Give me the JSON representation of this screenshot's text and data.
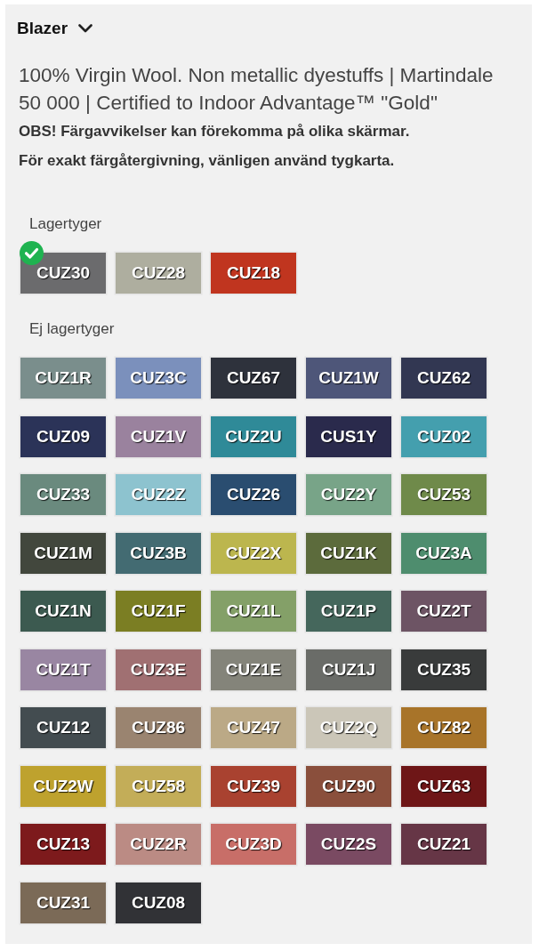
{
  "header": {
    "title": "Blazer",
    "expanded": true
  },
  "description": "100% Virgin Wool. Non metallic dyestuffs | Martindale 50 000 | Certified to Indoor Advantage™ \"Gold\"",
  "notes": [
    "OBS! Färgavvikelser kan förekomma på olika skärmar.",
    "För exakt färgåtergivning, vänligen använd tygkarta."
  ],
  "groups": [
    {
      "label": "Lagertyger",
      "swatches": [
        {
          "code": "CUZ30",
          "color": "#6b6b6d",
          "selected": true
        },
        {
          "code": "CUZ28",
          "color": "#aeae9f",
          "selected": false
        },
        {
          "code": "CUZ18",
          "color": "#c0351f",
          "selected": false
        }
      ]
    },
    {
      "label": "Ej lagertyger",
      "swatches": [
        {
          "code": "CUZ1R",
          "color": "#7a8e8c",
          "selected": false
        },
        {
          "code": "CUZ3C",
          "color": "#7b90bc",
          "selected": false
        },
        {
          "code": "CUZ67",
          "color": "#2e323c",
          "selected": false
        },
        {
          "code": "CUZ1W",
          "color": "#4e5679",
          "selected": false
        },
        {
          "code": "CUZ62",
          "color": "#323752",
          "selected": false
        },
        {
          "code": "CUZ09",
          "color": "#2b3358",
          "selected": false
        },
        {
          "code": "CUZ1V",
          "color": "#9a829e",
          "selected": false
        },
        {
          "code": "CUZ2U",
          "color": "#2f8a98",
          "selected": false
        },
        {
          "code": "CUS1Y",
          "color": "#2a2a4c",
          "selected": false
        },
        {
          "code": "CUZ02",
          "color": "#449fae",
          "selected": false
        },
        {
          "code": "CUZ33",
          "color": "#6a8a7e",
          "selected": false
        },
        {
          "code": "CUZ2Z",
          "color": "#8dc3cf",
          "selected": false
        },
        {
          "code": "CUZ26",
          "color": "#2a4d70",
          "selected": false
        },
        {
          "code": "CUZ2Y",
          "color": "#78a488",
          "selected": false
        },
        {
          "code": "CUZ53",
          "color": "#6f8a4a",
          "selected": false
        },
        {
          "code": "CUZ1M",
          "color": "#42473d",
          "selected": false
        },
        {
          "code": "CUZ3B",
          "color": "#436b72",
          "selected": false
        },
        {
          "code": "CUZ2X",
          "color": "#bcb64e",
          "selected": false
        },
        {
          "code": "CUZ1K",
          "color": "#5c6b3c",
          "selected": false
        },
        {
          "code": "CUZ3A",
          "color": "#4e8d6e",
          "selected": false
        },
        {
          "code": "CUZ1N",
          "color": "#3c5a50",
          "selected": false
        },
        {
          "code": "CUZ1F",
          "color": "#7b7e23",
          "selected": false
        },
        {
          "code": "CUZ1L",
          "color": "#84a068",
          "selected": false
        },
        {
          "code": "CUZ1P",
          "color": "#45675c",
          "selected": false
        },
        {
          "code": "CUZ2T",
          "color": "#6d5464",
          "selected": false
        },
        {
          "code": "CUZ1T",
          "color": "#9986a2",
          "selected": false
        },
        {
          "code": "CUZ3E",
          "color": "#a07072",
          "selected": false
        },
        {
          "code": "CUZ1E",
          "color": "#84847a",
          "selected": false
        },
        {
          "code": "CUZ1J",
          "color": "#6a6c68",
          "selected": false
        },
        {
          "code": "CUZ35",
          "color": "#393b3b",
          "selected": false
        },
        {
          "code": "CUZ12",
          "color": "#434c50",
          "selected": false
        },
        {
          "code": "CUZ86",
          "color": "#9a8470",
          "selected": false
        },
        {
          "code": "CUZ47",
          "color": "#bba986",
          "selected": false
        },
        {
          "code": "CUZ2Q",
          "color": "#cbc6b8",
          "selected": false
        },
        {
          "code": "CUZ82",
          "color": "#a87429",
          "selected": false
        },
        {
          "code": "CUZ2W",
          "color": "#bea22e",
          "selected": false
        },
        {
          "code": "CUZ58",
          "color": "#c3ad58",
          "selected": false
        },
        {
          "code": "CUZ39",
          "color": "#a94230",
          "selected": false
        },
        {
          "code": "CUZ90",
          "color": "#8a4f3c",
          "selected": false
        },
        {
          "code": "CUZ63",
          "color": "#6e1617",
          "selected": false
        },
        {
          "code": "CUZ13",
          "color": "#7d1a1c",
          "selected": false
        },
        {
          "code": "CUZ2R",
          "color": "#bb8b84",
          "selected": false
        },
        {
          "code": "CUZ3D",
          "color": "#c86e68",
          "selected": false
        },
        {
          "code": "CUZ2S",
          "color": "#7a4a62",
          "selected": false
        },
        {
          "code": "CUZ21",
          "color": "#663646",
          "selected": false
        },
        {
          "code": "CUZ31",
          "color": "#7b6a57",
          "selected": false
        },
        {
          "code": "CUZ08",
          "color": "#313236",
          "selected": false
        }
      ]
    }
  ]
}
